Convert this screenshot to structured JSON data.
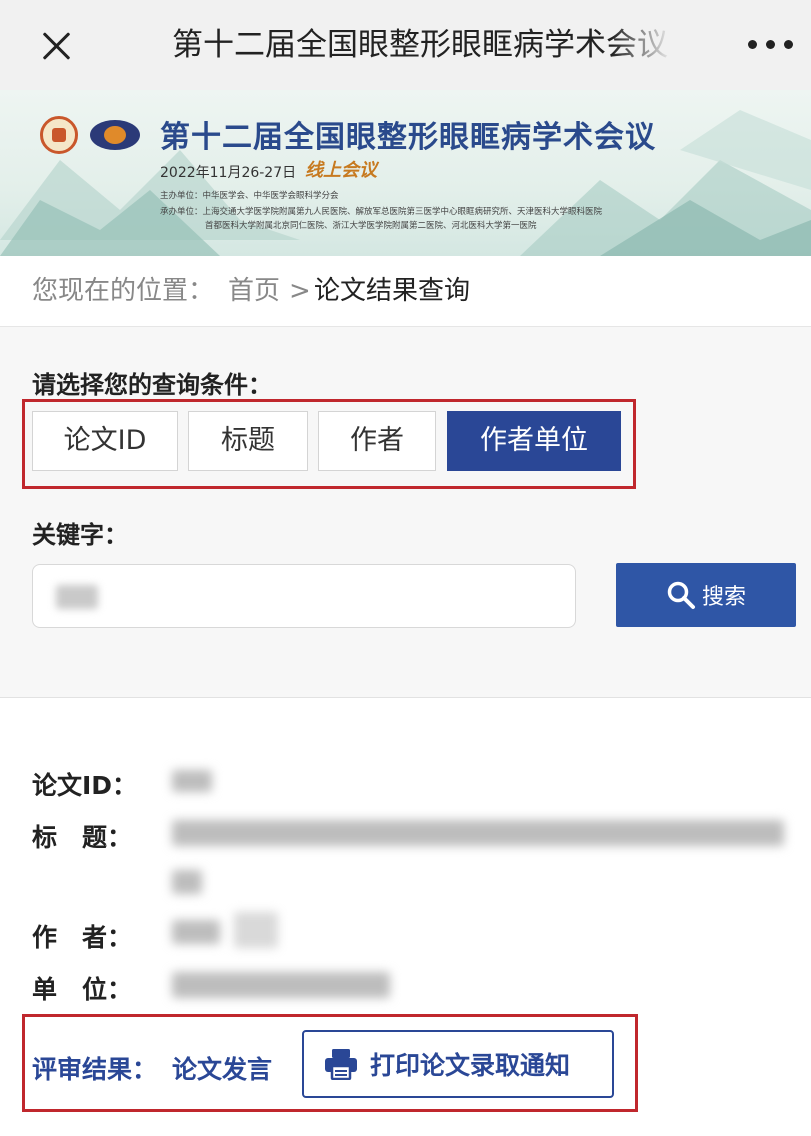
{
  "nav": {
    "title": "第十二届全国眼整形眼眶病学术会议"
  },
  "banner": {
    "title": "第十二届全国眼整形眼眶病学术会议",
    "date": "2022年11月26-27日",
    "online": "线上会议",
    "sponsor": "主办单位：中华医学会、中华医学会眼科学分会",
    "organizer": "承办单位：上海交通大学医学院附属第九人民医院、解放军总医院第三医学中心眼眶病研究所、天津医科大学眼科医院",
    "organizer2": "首都医科大学附属北京同仁医院、浙江大学医学院附属第二医院、河北医科大学第一医院"
  },
  "breadcrumb": {
    "label": "您现在的位置：",
    "home": "首页",
    "separator": ">",
    "current": "论文结果查询"
  },
  "search": {
    "condition_label": "请选择您的查询条件：",
    "options": [
      "论文ID",
      "标题",
      "作者",
      "作者单位"
    ],
    "active_option": "作者单位",
    "keyword_label": "关键字：",
    "keyword_value": "",
    "button_label": "搜索"
  },
  "result": {
    "id_label": "论文ID：",
    "title_label": "标　题：",
    "author_label": "作　者：",
    "unit_label": "单　位：",
    "review_label": "评审结果：",
    "review_value": "论文发言",
    "print_label": "打印论文录取通知"
  },
  "colors": {
    "accent": "#2a4796",
    "highlight_border": "#c0272d",
    "search_button": "#2f56a6"
  },
  "icons": {
    "close": "close-icon",
    "more": "more-icon",
    "search": "search-icon",
    "printer": "printer-icon"
  }
}
